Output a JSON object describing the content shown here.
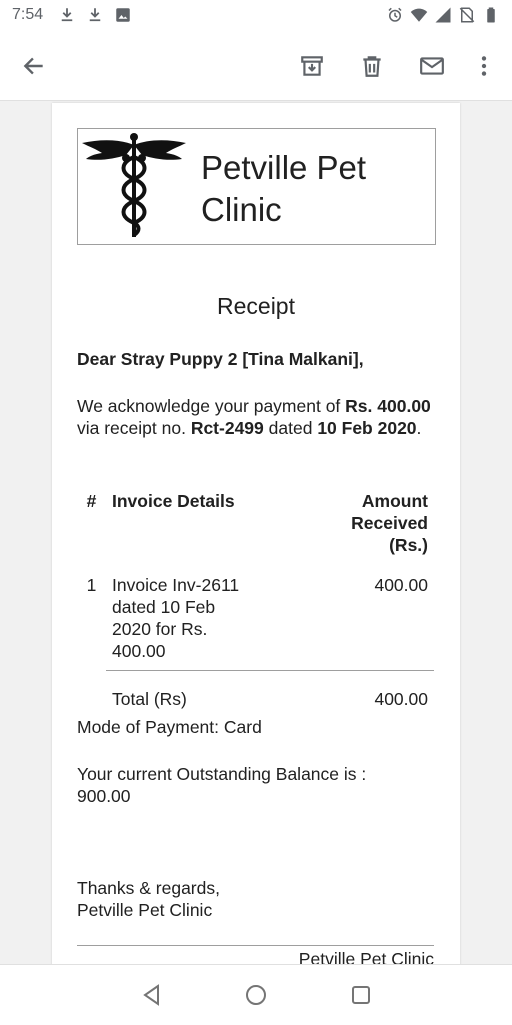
{
  "status_bar": {
    "time": "7:54",
    "left_icons": [
      "download-icon",
      "download-icon",
      "image-icon"
    ],
    "right_icons": [
      "alarm-icon",
      "wifi-icon",
      "signal-icon",
      "no-sim-icon",
      "battery-icon"
    ]
  },
  "app_bar": {
    "back_icon": "arrow-back-icon",
    "actions": [
      "archive-icon",
      "delete-icon",
      "mail-icon",
      "more-vert-icon"
    ]
  },
  "email": {
    "clinic_name": "Petville Pet Clinic",
    "receipt_title": "Receipt",
    "greeting": "Dear Stray Puppy 2 [Tina Malkani],",
    "ack": {
      "p1": "We acknowledge your payment of ",
      "amount": "Rs. 400.00",
      "p2": " via receipt no. ",
      "receipt_no": "Rct-2499",
      "p3": " dated ",
      "date": "10 Feb 2020",
      "p4": "."
    },
    "table": {
      "headers": {
        "num": "#",
        "details": "Invoice Details",
        "amount": "Amount Received (Rs.)"
      },
      "rows": [
        {
          "num": "1",
          "details": "Invoice Inv-2611 dated 10 Feb 2020 for Rs. 400.00",
          "amount": "400.00"
        }
      ],
      "total_label": "Total (Rs)",
      "total_value": "400.00"
    },
    "payment_mode": "Mode of Payment: Card",
    "balance": "Your current Outstanding Balance is : 900.00",
    "signoff_line1": "Thanks & regards,",
    "signoff_line2": "Petville Pet Clinic",
    "footer_clinic": "Petville Pet Clinic"
  },
  "nav_bar": {
    "buttons": [
      "back-triangle-icon",
      "home-circle-icon",
      "recents-square-icon"
    ]
  },
  "colors": {
    "background": "#ffffff",
    "content_background": "#f1f1f1",
    "icon_gray": "#5f6368",
    "text": "#212121"
  }
}
